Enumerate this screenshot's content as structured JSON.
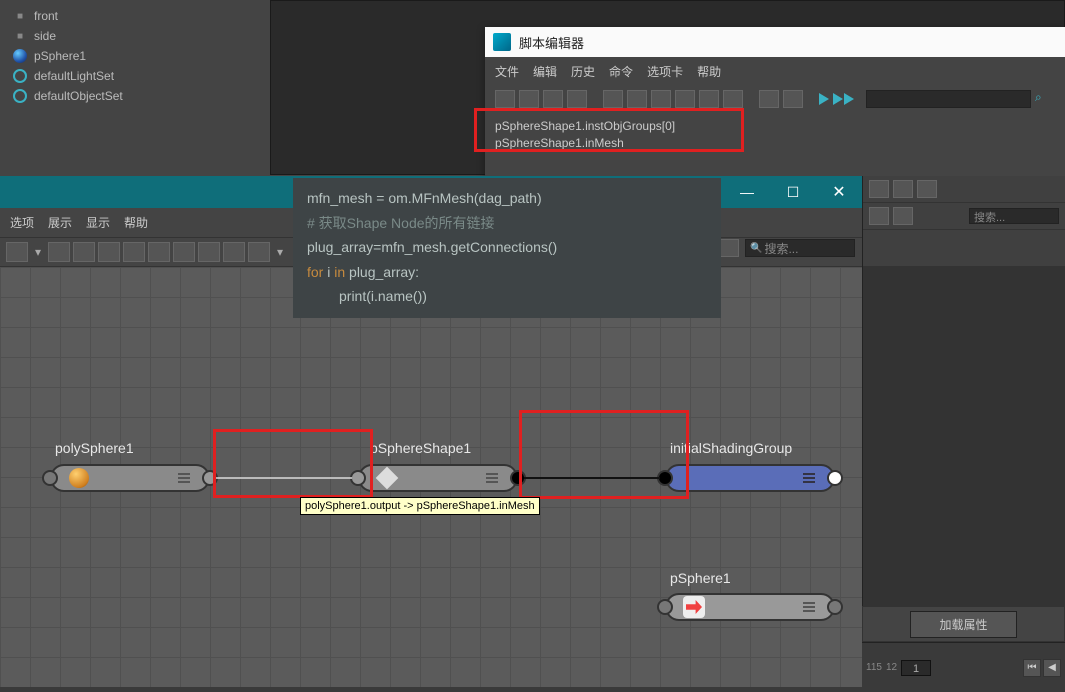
{
  "outliner": {
    "items": [
      {
        "icon": "camera",
        "label": "front"
      },
      {
        "icon": "camera",
        "label": "side"
      },
      {
        "icon": "sphere",
        "label": "pSphere1"
      },
      {
        "icon": "set",
        "label": "defaultLightSet"
      },
      {
        "icon": "set",
        "label": "defaultObjectSet"
      }
    ]
  },
  "script_editor": {
    "title": "脚本编辑器",
    "menu": [
      "文件",
      "编辑",
      "历史",
      "命令",
      "选项卡",
      "帮助"
    ],
    "output": [
      "pSphereShape1.instObjGroups[0]",
      "pSphereShape1.inMesh"
    ]
  },
  "code_tooltip": {
    "lines": [
      {
        "pre": "mfn_mesh = om.MFnMesh(dag_path)"
      },
      {
        "comment": "# 获取Shape Node的所有链接"
      },
      {
        "pre": "plug_array=mfn_mesh.getConnections()"
      },
      {
        "mixed": true,
        "kw1": "for",
        "mid": " i ",
        "kw2": "in",
        "tail": " plug_array:"
      },
      {
        "indent": true,
        "fn": "print",
        "tail": "(i.name())"
      }
    ]
  },
  "node_editor": {
    "window_buttons": {
      "min": "—",
      "max": "☐",
      "close": "✕"
    },
    "menu": [
      "选项",
      "展示",
      "显示",
      "帮助"
    ],
    "search_placeholder": "搜索..."
  },
  "nodes": {
    "poly": {
      "label": "polySphere1"
    },
    "shape": {
      "label": "pSphereShape1"
    },
    "shading": {
      "label": "initialShadingGroup"
    },
    "transform": {
      "label": "pSphere1"
    }
  },
  "connection_tooltip": "polySphere1.output -> pSphereShape1.inMesh",
  "right_panel": {
    "search_placeholder": "搜索...",
    "load_attr": "加载属性"
  },
  "timeline": {
    "tick1": "115",
    "tick2": "12",
    "frame": "1"
  }
}
